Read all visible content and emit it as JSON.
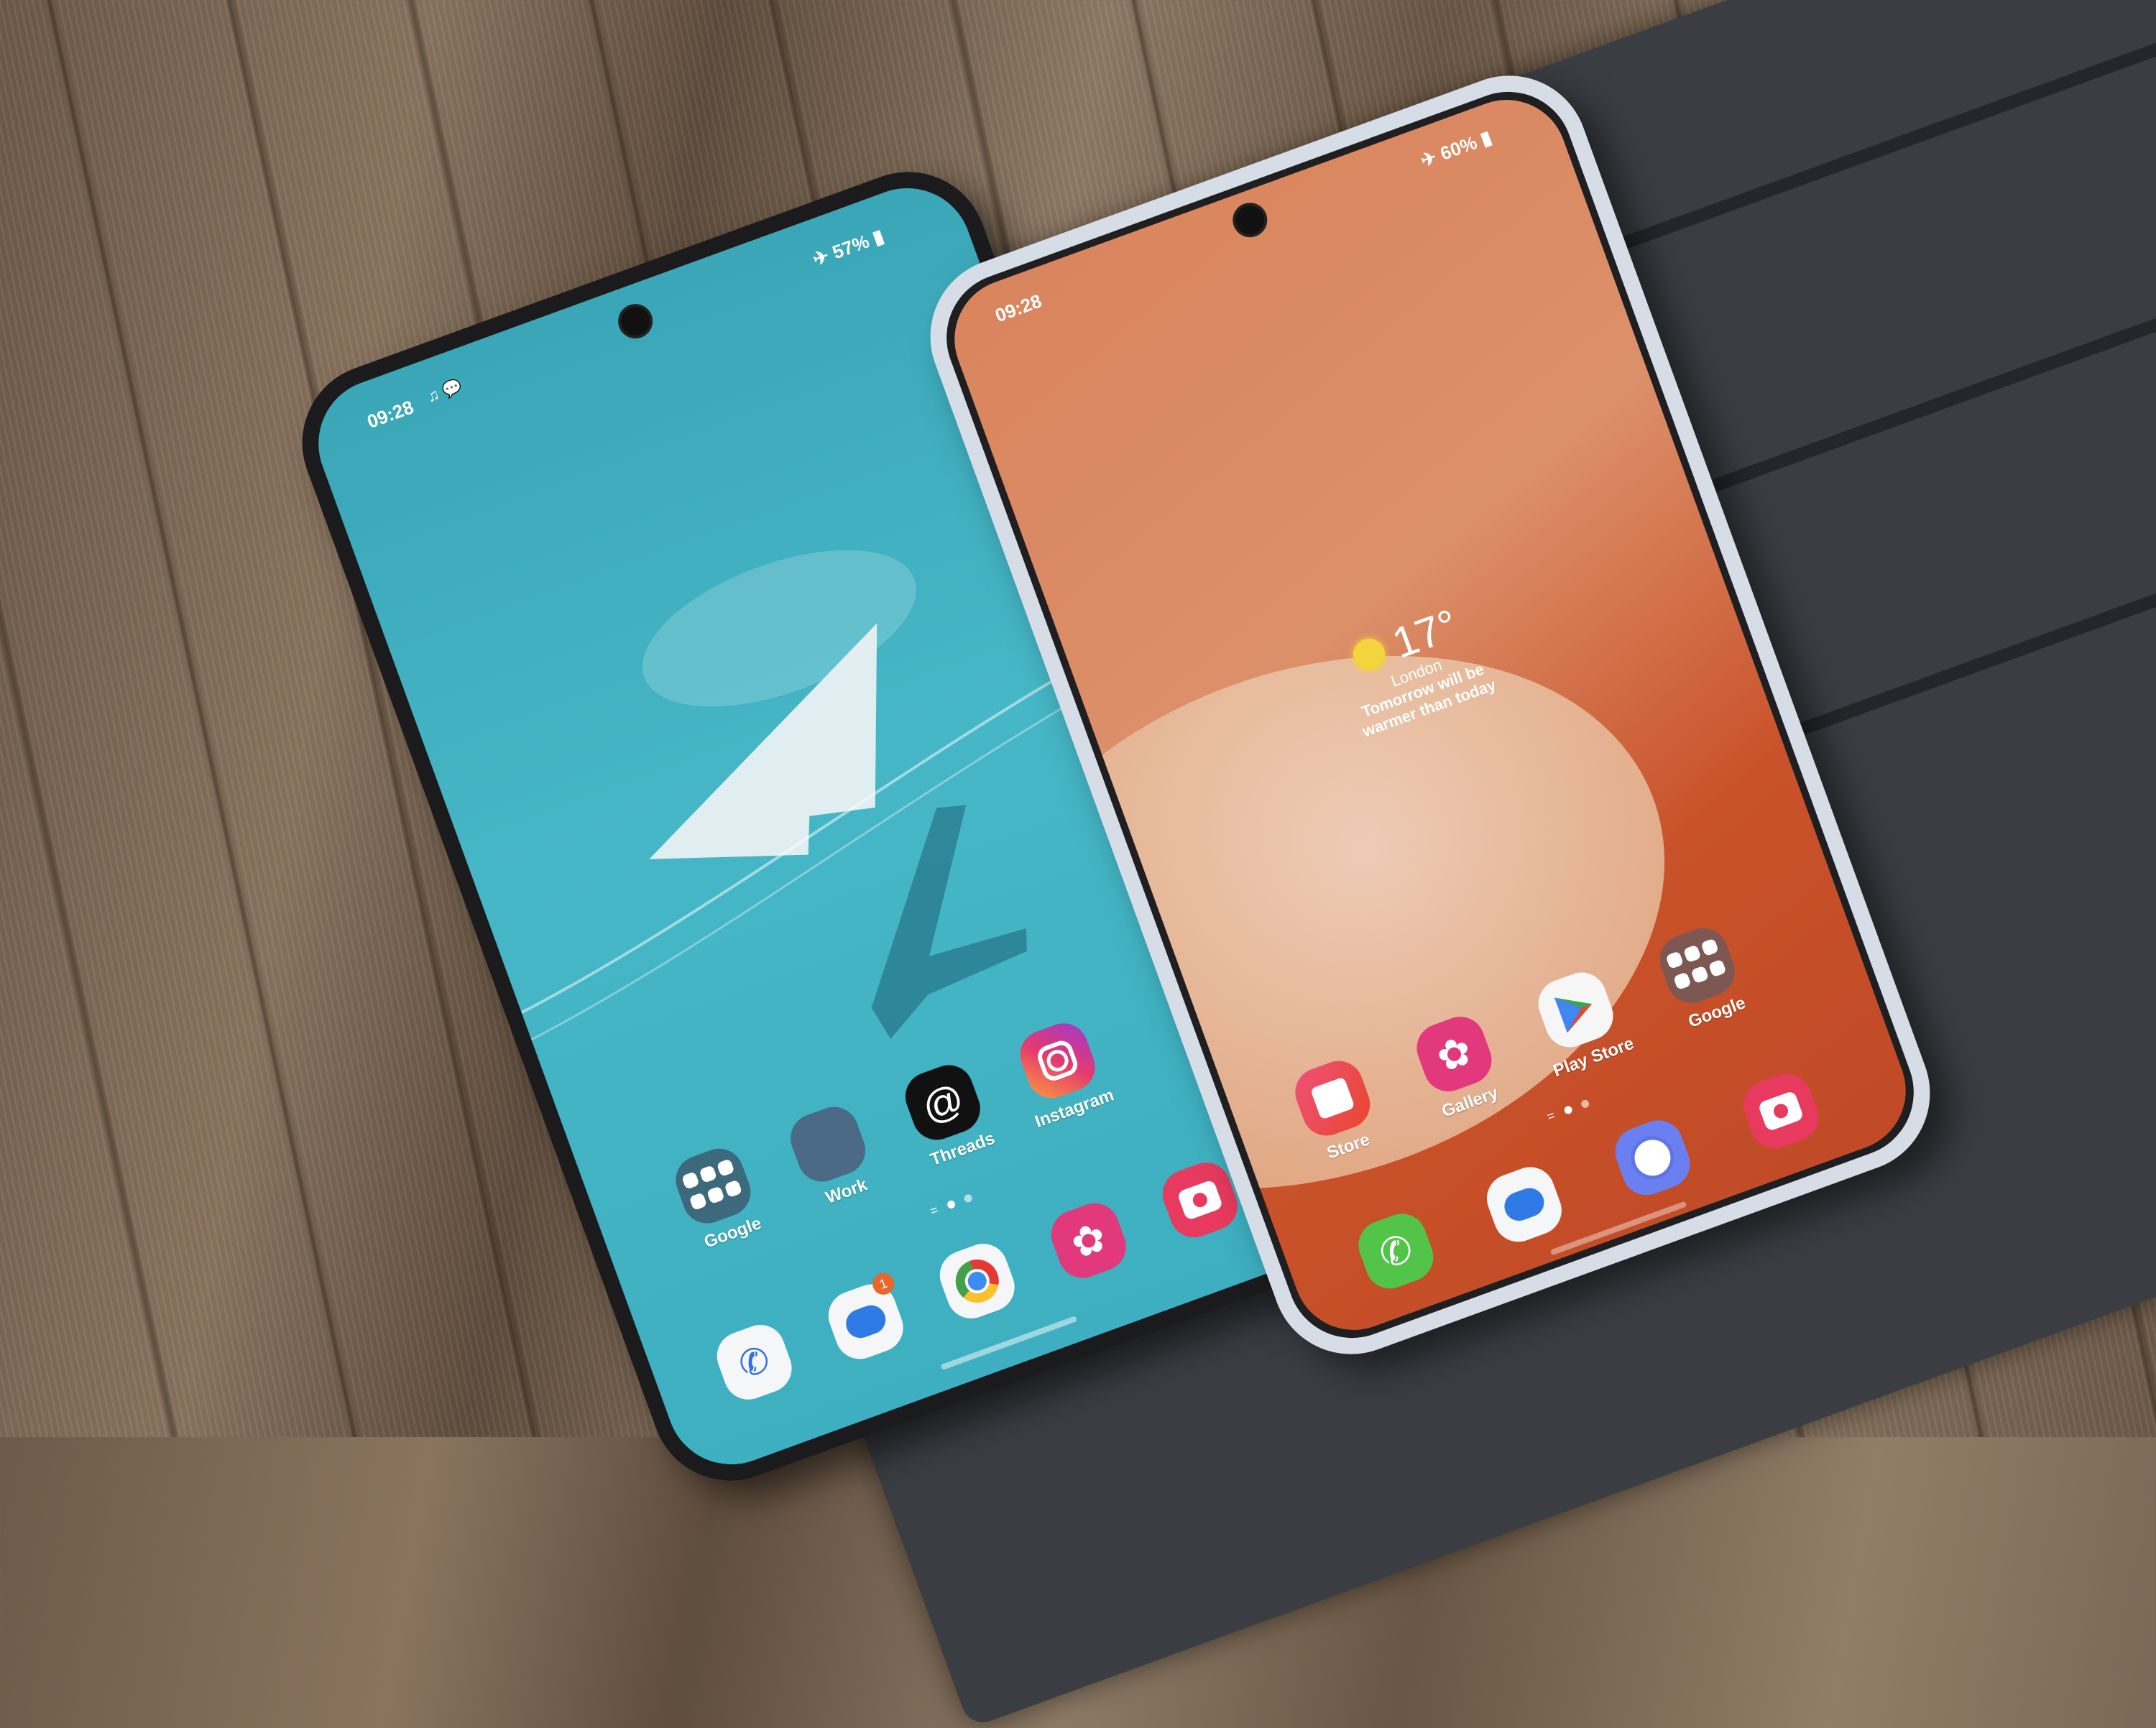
{
  "scene": "Two foldable smartphones lying open on a dark metal table over a wooden deck",
  "colors": {
    "left_wallpaper": "#3fb3c4",
    "right_wallpaper": "#d9845c",
    "right_accent": "#c9522a",
    "left_frame": "#1b1b1d",
    "right_frame": "#d7dde6",
    "table": "#3a3d42"
  },
  "left_phone": {
    "status": {
      "time": "09:28",
      "left_icons": [
        "notification-icon",
        "chat-icon"
      ],
      "airplane_icon": "airplane-icon",
      "battery": "57%"
    },
    "wallpaper": "paper-plane-with-airplane-shadow",
    "home_apps": [
      {
        "label": "Google",
        "icon": "google-folder-icon"
      },
      {
        "label": "Work",
        "icon": "work-folder-icon"
      },
      {
        "label": "Threads",
        "icon": "threads-icon"
      },
      {
        "label": "Instagram",
        "icon": "instagram-icon"
      }
    ],
    "page_indicator": {
      "pages": 2,
      "current": 1
    },
    "dock": [
      {
        "name": "phone",
        "icon": "phone-icon"
      },
      {
        "name": "messages",
        "icon": "messages-icon",
        "badge": "1"
      },
      {
        "name": "chrome",
        "icon": "chrome-icon"
      },
      {
        "name": "gallery",
        "icon": "gallery-icon"
      },
      {
        "name": "camera",
        "icon": "camera-icon"
      }
    ]
  },
  "right_phone": {
    "status": {
      "time": "09:28",
      "airplane_icon": "airplane-icon",
      "battery": "60%"
    },
    "weather": {
      "temperature": "17°",
      "location": "London",
      "forecast_line1": "Tomorrow will be",
      "forecast_line2": "warmer than today",
      "icon": "sun-icon"
    },
    "home_apps": [
      {
        "label": "Store",
        "icon": "store-icon"
      },
      {
        "label": "Gallery",
        "icon": "gallery-icon"
      },
      {
        "label": "Play Store",
        "icon": "play-store-icon"
      },
      {
        "label": "Google",
        "icon": "google-folder-icon"
      }
    ],
    "page_indicator": {
      "pages": 2,
      "current": 1
    },
    "dock": [
      {
        "name": "phone",
        "icon": "phone-icon"
      },
      {
        "name": "messages",
        "icon": "messages-icon"
      },
      {
        "name": "internet",
        "icon": "internet-icon"
      },
      {
        "name": "camera",
        "icon": "camera-icon"
      }
    ]
  }
}
